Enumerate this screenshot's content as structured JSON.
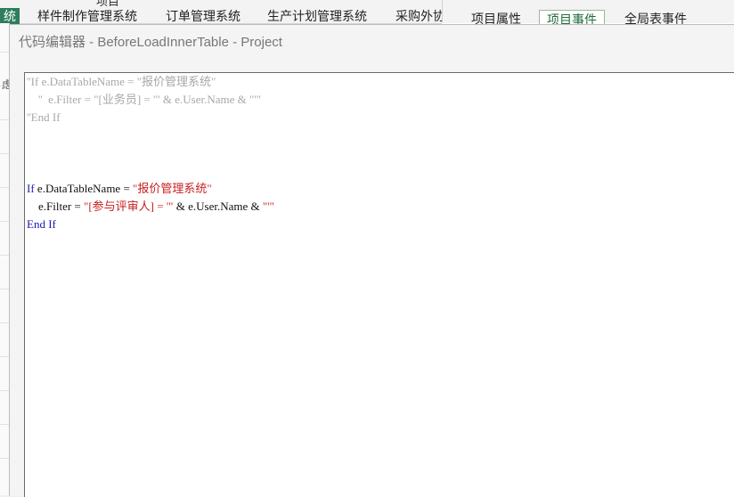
{
  "background_app": {
    "column_header": "项目",
    "module_tabs": [
      {
        "label": "统"
      },
      {
        "label": "样件制作管理系统"
      },
      {
        "label": "订单管理系统"
      },
      {
        "label": "生产计划管理系统"
      },
      {
        "label": "采购外协"
      }
    ],
    "right_tabs": [
      {
        "label": "项目属性"
      },
      {
        "label": "项目事件"
      },
      {
        "label": "全局表事件"
      }
    ],
    "left_fragment": "虑"
  },
  "dialog": {
    "title": "代码编辑器 - BeforeLoadInnerTable - Project"
  },
  "code_editor": {
    "lines": [
      {
        "parts": [
          {
            "text": "''If e.DataTableName = ",
            "style": "comment"
          },
          {
            "text": "\"报价管理系统\"",
            "style": "comment"
          }
        ]
      },
      {
        "parts": [
          {
            "text": "    ''  e.Filter = \"[业务员] = '\" & e.User.Name & \"'\"",
            "style": "comment"
          }
        ]
      },
      {
        "parts": [
          {
            "text": "''End If",
            "style": "comment"
          }
        ]
      },
      {
        "parts": []
      },
      {
        "parts": []
      },
      {
        "parts": [
          {
            "text": "If",
            "style": "kw"
          },
          {
            "text": " e.DataTableName = ",
            "style": "normal"
          },
          {
            "text": "\"报价管理系统\"",
            "style": "str"
          }
        ]
      },
      {
        "parts": [
          {
            "text": "    e.Filter = ",
            "style": "normal"
          },
          {
            "text": "\"[参与评审人] = '\"",
            "style": "str"
          },
          {
            "text": " & e.User.Name & ",
            "style": "normal"
          },
          {
            "text": "\"'\"",
            "style": "str"
          }
        ]
      },
      {
        "parts": [
          {
            "text": "End If",
            "style": "kw"
          }
        ]
      }
    ]
  }
}
